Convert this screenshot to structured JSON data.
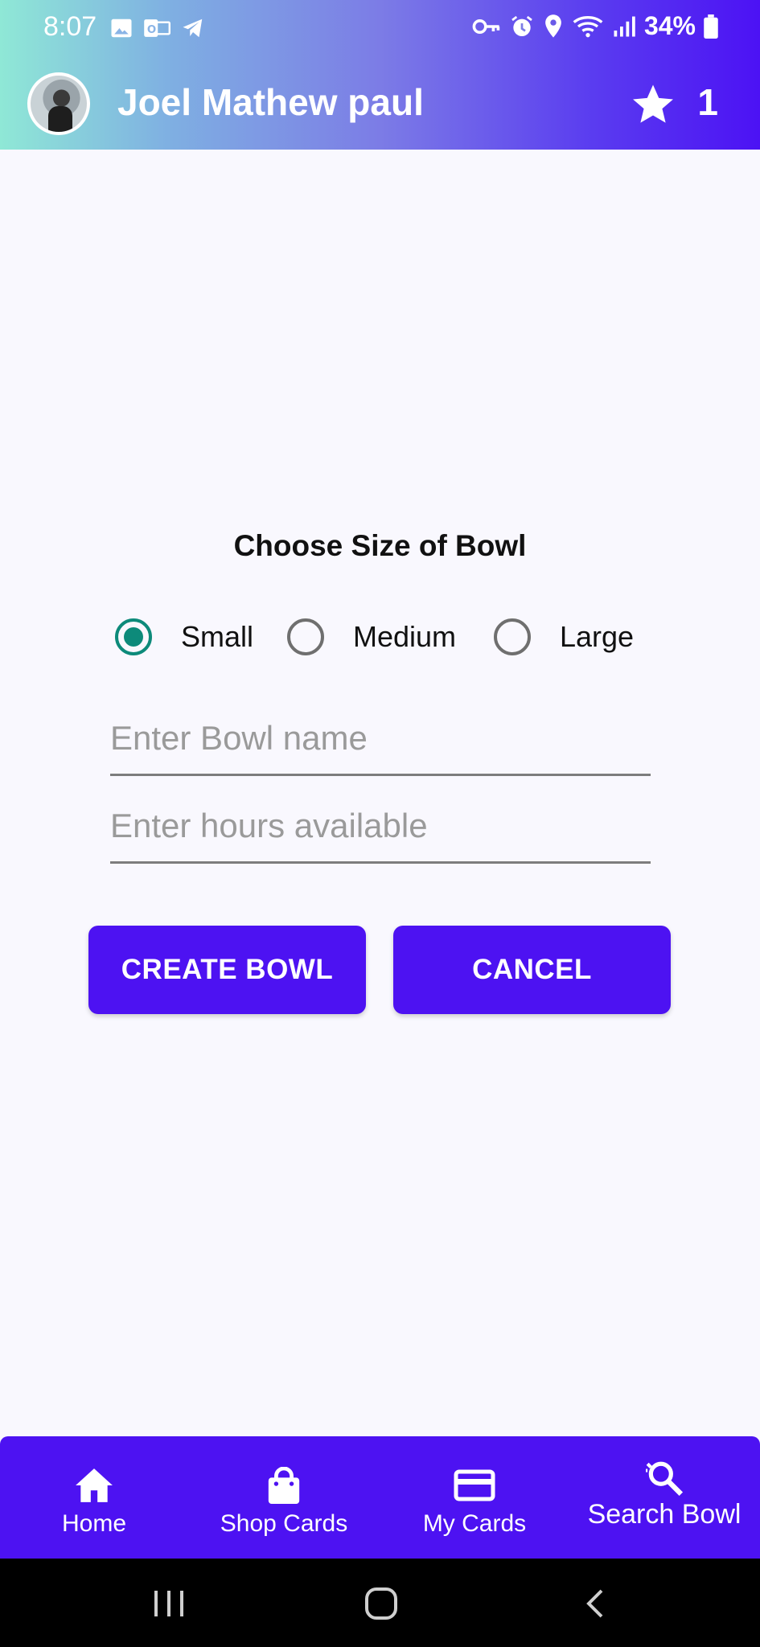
{
  "status_bar": {
    "time": "8:07",
    "battery": "34%",
    "left_icons": [
      "gallery-icon",
      "outlook-icon",
      "telegram-icon"
    ],
    "right_icons": [
      "vpn-key-icon",
      "alarm-icon",
      "location-icon",
      "wifi-icon",
      "signal-icon",
      "battery-icon"
    ]
  },
  "app_bar": {
    "user_name": "Joel Mathew paul",
    "star_count": "1"
  },
  "form": {
    "title": "Choose Size of Bowl",
    "size_options": [
      {
        "label": "Small",
        "selected": true
      },
      {
        "label": "Medium",
        "selected": false
      },
      {
        "label": "Large",
        "selected": false
      }
    ],
    "bowl_name": {
      "value": "",
      "placeholder": "Enter Bowl name"
    },
    "hours": {
      "value": "",
      "placeholder": "Enter hours available"
    },
    "create_label": "CREATE BOWL",
    "cancel_label": "CANCEL"
  },
  "bottom_nav": {
    "items": [
      {
        "label": "Home",
        "icon": "home-icon"
      },
      {
        "label": "Shop Cards",
        "icon": "shopping-bag-icon"
      },
      {
        "label": "My Cards",
        "icon": "credit-card-icon"
      },
      {
        "label": "Search Bowl",
        "icon": "search-bowl-icon"
      }
    ]
  },
  "colors": {
    "primary": "#4d12f2",
    "radio_selected": "#0d8a7a",
    "background": "#f9f8fe"
  }
}
